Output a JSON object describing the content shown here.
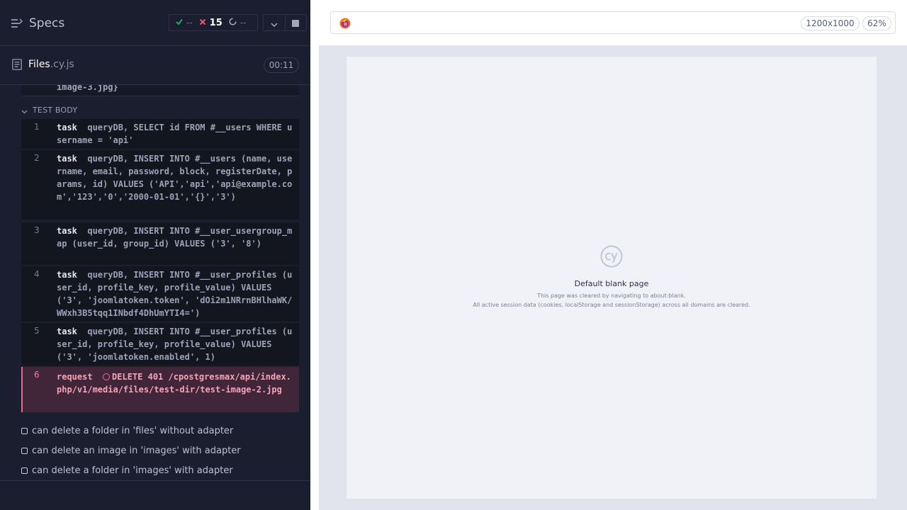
{
  "reporter": {
    "specs_label": "Specs",
    "stats": {
      "passed": "--",
      "failed": "15",
      "pending": "--"
    },
    "file": {
      "name": "Files",
      "ext": ".cy.js",
      "duration": "00:11"
    },
    "hook_tail": "image-3.jpg}",
    "test_body_label": "TEST BODY",
    "commands": [
      {
        "num": "1",
        "name": "task",
        "message": "queryDB, SELECT id FROM #__users WHERE username = 'api'",
        "state": "passed"
      },
      {
        "num": "2",
        "name": "task",
        "message": "queryDB, INSERT INTO #__users (name, username, email, password, block, registerDate, params, id) VALUES ('API','api','api@example.com','123','0','2000-01-01','{}','3')",
        "state": "passed"
      },
      {
        "num": "3",
        "name": "task",
        "message": "queryDB, INSERT INTO #__user_usergroup_map (user_id, group_id) VALUES ('3', '8')",
        "state": "passed"
      },
      {
        "num": "4",
        "name": "task",
        "message": "queryDB, INSERT INTO #__user_profiles (user_id, profile_key, profile_value) VALUES ('3', 'joomlatoken.token', 'dOi2m1NRrnBHlhaWK/WWxh3B5tqq1INbdf4DhUmYTI4=')",
        "state": "passed"
      },
      {
        "num": "5",
        "name": "task",
        "message": "queryDB, INSERT INTO #__user_profiles (user_id, profile_key, profile_value) VALUES ('3', 'joomlatoken.enabled', 1)",
        "state": "passed"
      },
      {
        "num": "6",
        "name": "request",
        "message": "DELETE 401 /cpostgresmax/api/index.php/v1/media/files/test-dir/test-image-2.jpg",
        "state": "failed"
      }
    ],
    "tests": [
      "can delete a folder in 'files' without adapter",
      "can delete an image in 'images' with adapter",
      "can delete a folder in 'images' with adapter"
    ]
  },
  "aut": {
    "viewport": "1200x1000",
    "zoom": "62%",
    "blank_title": "Default blank page",
    "blank_line1": "This page was cleared by navigating to about:blank.",
    "blank_line2": "All active session data (cookies, localStorage and sessionStorage) across all domains are cleared."
  },
  "colors": {
    "reporter_bg": "#1b1e2e",
    "passed": "#1fa971",
    "failed": "#e45770",
    "failed_row_bg": "#412538",
    "aut_bg": "#e1e3ed"
  },
  "icons": [
    "specs-list-icon",
    "check-icon",
    "x-icon",
    "spinner-icon",
    "chevron-down-icon",
    "stop-icon",
    "document-icon",
    "firefox-icon",
    "cypress-logo-icon",
    "checkbox-icon"
  ]
}
